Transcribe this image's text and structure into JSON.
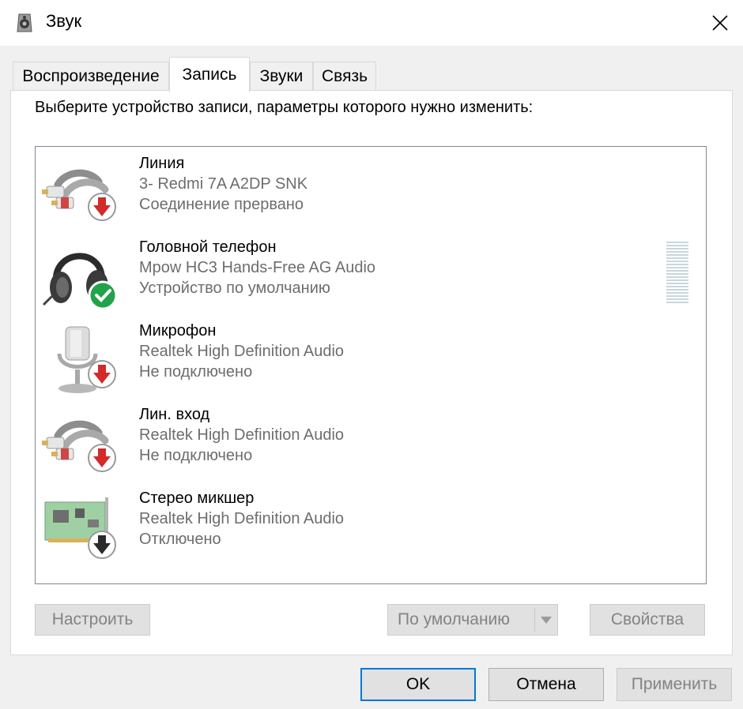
{
  "window": {
    "title": "Звук"
  },
  "tabs": [
    {
      "label": "Воспроизведение"
    },
    {
      "label": "Запись"
    },
    {
      "label": "Звуки"
    },
    {
      "label": "Связь"
    }
  ],
  "prompt": "Выберите устройство записи, параметры которого нужно изменить:",
  "devices": [
    {
      "name": "Линия",
      "sub": "3- Redmi 7A A2DP SNK",
      "status": "Соединение прервано",
      "icon": "line-cable-icon",
      "badge": "disconnected-arrow-icon"
    },
    {
      "name": "Головной телефон",
      "sub": "Mpow HC3 Hands-Free AG Audio",
      "status": "Устройство по умолчанию",
      "icon": "headset-icon",
      "badge": "default-check-icon"
    },
    {
      "name": "Микрофон",
      "sub": "Realtek High Definition Audio",
      "status": "Не подключено",
      "icon": "microphone-icon",
      "badge": "disconnected-arrow-icon"
    },
    {
      "name": "Лин. вход",
      "sub": "Realtek High Definition Audio",
      "status": "Не подключено",
      "icon": "line-cable-icon",
      "badge": "disconnected-arrow-icon"
    },
    {
      "name": "Стерео микшер",
      "sub": "Realtek High Definition Audio",
      "status": "Отключено",
      "icon": "sound-card-icon",
      "badge": "disabled-arrow-icon"
    }
  ],
  "panel_buttons": {
    "configure": "Настроить",
    "set_default": "По умолчанию",
    "properties": "Свойства"
  },
  "dialog_buttons": {
    "ok": "OK",
    "cancel": "Отмена",
    "apply": "Применить"
  },
  "colors": {
    "accent": "#0078d7",
    "error_red": "#d32a2a",
    "ok_green": "#22a34a"
  }
}
